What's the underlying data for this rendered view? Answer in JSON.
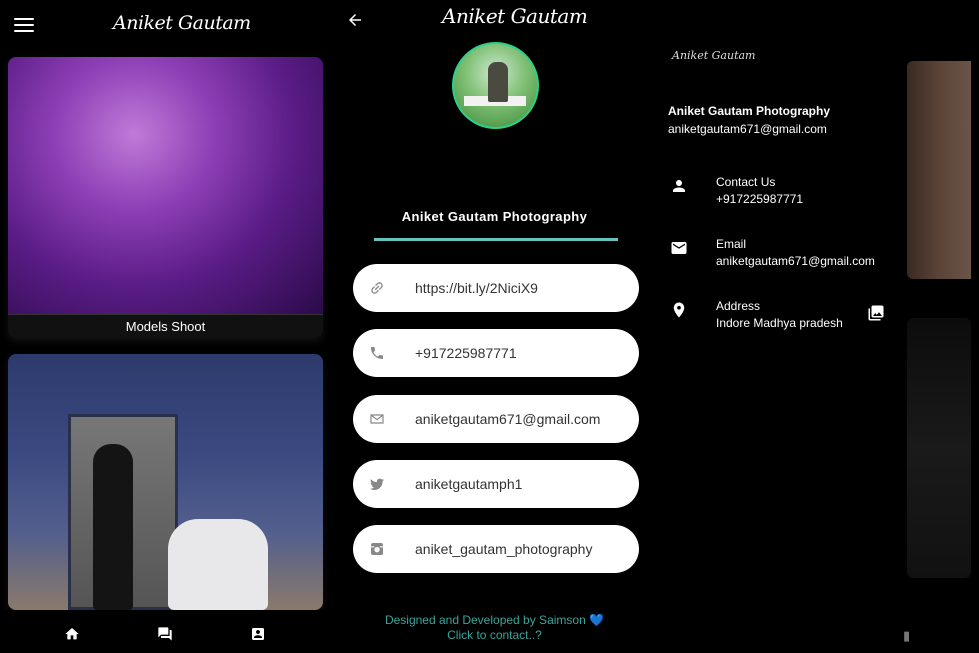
{
  "left": {
    "brand": "Aniket Gautam",
    "card1_caption": "Models Shoot",
    "nav": {
      "home_icon": "home-icon",
      "chat_icon": "chat-icon",
      "contact_icon": "contact-card-icon"
    }
  },
  "middle": {
    "brand": "Aniket Gautam",
    "back_icon": "arrow-back-icon",
    "profile_name": "Aniket Gautam Photography",
    "links": [
      {
        "icon": "link-icon",
        "text": "https://bit.ly/2NiciX9"
      },
      {
        "icon": "phone-icon",
        "text": "+917225987771"
      },
      {
        "icon": "mail-icon",
        "text": "aniketgautam671@gmail.com"
      },
      {
        "icon": "twitter-icon",
        "text": "aniketgautamph1"
      },
      {
        "icon": "instagram-icon",
        "text": "aniket_gautam_photography"
      }
    ],
    "footer_line1": "Designed and Developed by Saimson",
    "footer_heart": "💙",
    "footer_line2": "Click to contact..?",
    "accent_color": "#65c2bd",
    "footer_color": "#3aa59b"
  },
  "drawer": {
    "brand": "Aniket Gautam",
    "name": "Aniket Gautam Photography",
    "email": "aniketgautam671@gmail.com",
    "items": [
      {
        "icon": "person-icon",
        "title": "Contact Us",
        "value": "+917225987771"
      },
      {
        "icon": "email-icon",
        "title": "Email",
        "value": "aniketgautam671@gmail.com"
      },
      {
        "icon": "location-pin-icon",
        "title": "Address",
        "value": "Indore Madhya pradesh"
      }
    ],
    "gallery_icon": "photo-library-icon"
  }
}
